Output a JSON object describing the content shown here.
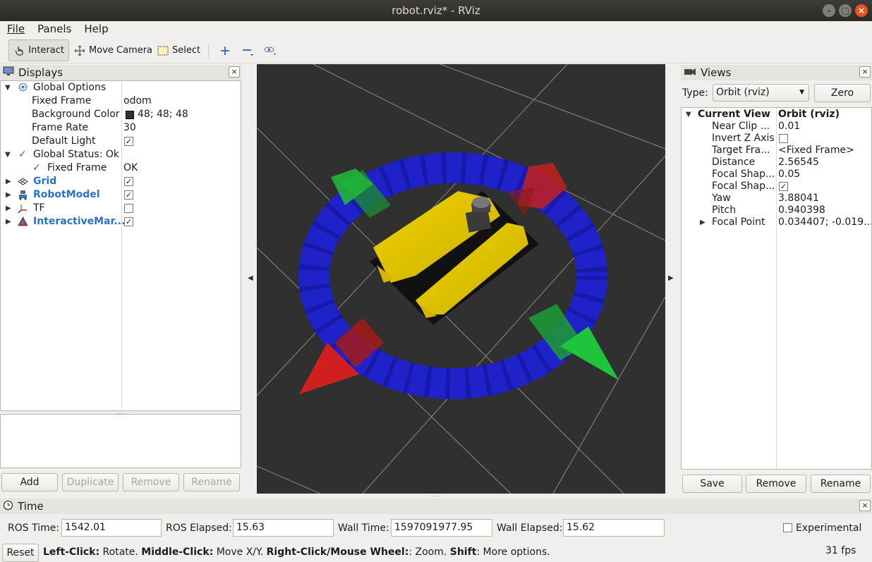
{
  "window": {
    "title": "robot.rviz* - RViz"
  },
  "menu": [
    "File",
    "Panels",
    "Help"
  ],
  "toolbar": {
    "interact": "Interact",
    "move_camera": "Move Camera",
    "select": "Select"
  },
  "displays": {
    "title": "Displays",
    "rows": {
      "global_options": "Global Options",
      "fixed_frame_label": "Fixed Frame",
      "fixed_frame_value": "odom",
      "background_label": "Background Color",
      "background_value": "48; 48; 48",
      "frame_rate_label": "Frame Rate",
      "frame_rate_value": "30",
      "default_light_label": "Default Light",
      "global_status": "Global Status: Ok",
      "status_fixed_frame": "Fixed Frame",
      "status_fixed_frame_value": "OK",
      "grid": "Grid",
      "robot_model": "RobotModel",
      "tf": "TF",
      "interactive": "InteractiveMar..."
    },
    "buttons": {
      "add": "Add",
      "duplicate": "Duplicate",
      "remove": "Remove",
      "rename": "Rename"
    }
  },
  "views": {
    "title": "Views",
    "type_label": "Type:",
    "type_value": "Orbit (rviz)",
    "zero": "Zero",
    "rows": {
      "current_view": "Current View",
      "current_view_value": "Orbit (rviz)",
      "near_clip": "Near Clip ...",
      "near_clip_value": "0.01",
      "invert_z": "Invert Z Axis",
      "target_frame": "Target Fra...",
      "target_frame_value": "<Fixed Frame>",
      "distance": "Distance",
      "distance_value": "2.56545",
      "focal_shape1": "Focal Shap...",
      "focal_shape1_value": "0.05",
      "focal_shape2": "Focal Shap...",
      "yaw": "Yaw",
      "yaw_value": "3.88041",
      "pitch": "Pitch",
      "pitch_value": "0.940398",
      "focal_point": "Focal Point",
      "focal_point_value": "0.034407; -0.019..."
    },
    "buttons": {
      "save": "Save",
      "remove": "Remove",
      "rename": "Rename"
    }
  },
  "time": {
    "title": "Time",
    "ros_time_label": "ROS Time:",
    "ros_time": "1542.01",
    "ros_elapsed_label": "ROS Elapsed:",
    "ros_elapsed": "15.63",
    "wall_time_label": "Wall Time:",
    "wall_time": "1597091977.95",
    "wall_elapsed_label": "Wall Elapsed:",
    "wall_elapsed": "15.62",
    "experimental": "Experimental"
  },
  "status": {
    "reset": "Reset",
    "left_click": "Left-Click:",
    "left_click_desc": " Rotate. ",
    "middle_click": "Middle-Click:",
    "middle_click_desc": " Move X/Y. ",
    "right_click": "Right-Click/Mouse Wheel:",
    "right_click_desc": ": Zoom. ",
    "shift": "Shift",
    "shift_desc": ": More options.",
    "fps": "31 fps"
  },
  "colors": {
    "background": "#303030",
    "accent": "#e95420",
    "link_blue": "#2a73c7"
  }
}
